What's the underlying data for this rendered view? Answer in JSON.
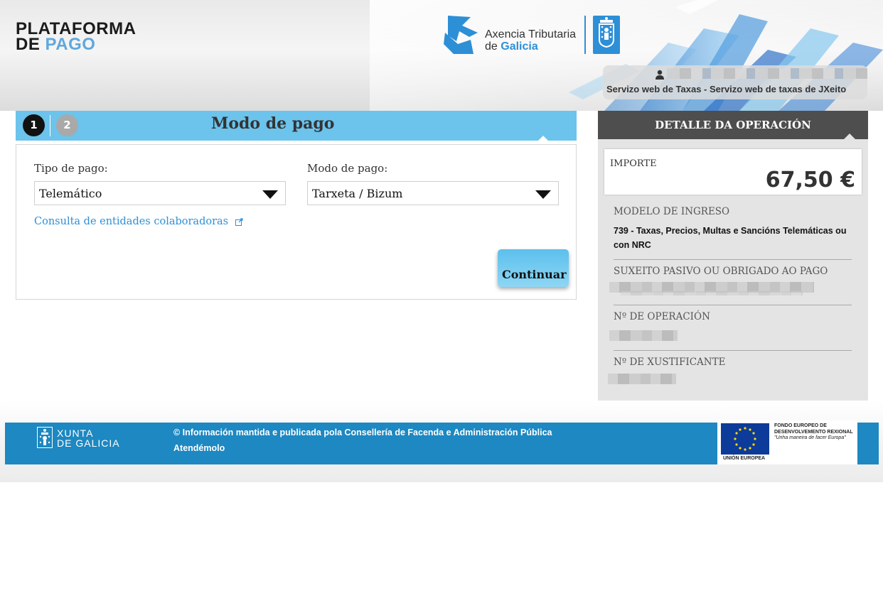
{
  "header": {
    "logo_line1": "PLATAFORMA",
    "logo_line2_a": "DE ",
    "logo_line2_b": "PAGO",
    "agency_line1": "Axencia Tributaria",
    "agency_line2_a": "de ",
    "agency_line2_b": "Galicia",
    "service_text": "Servizo web de Taxas - Servizo web de taxas de JXeito"
  },
  "steps": {
    "step1": "1",
    "step2": "2",
    "title": "Modo de pago"
  },
  "form": {
    "tipo_label": "Tipo de pago:",
    "tipo_value": "Telemático",
    "modo_label": "Modo de pago:",
    "modo_value": "Tarxeta / Bizum",
    "entidades_link": "Consulta de entidades colaboradoras",
    "continue_label": "Continuar"
  },
  "detail": {
    "title": "DETALLE DA OPERACIÓN",
    "importe_label": "IMPORTE",
    "importe_value": "67,50 €",
    "modelo_label": "MODELO DE INGRESO",
    "modelo_value": "739 - Taxas, Precios, Multas e Sancións Telemáticas ou con NRC",
    "suxeito_label": "SUXEITO PASIVO OU OBRIGADO AO PAGO",
    "operacion_label": "Nº DE OPERACIÓN",
    "xustificante_label": "Nº DE XUSTIFICANTE"
  },
  "footer": {
    "xunta_line1": "XUNTA",
    "xunta_line2": "DE GALICIA",
    "copyright": "© Información mantida e publicada pola Consellería de Facenda e Administración Pública",
    "atendemolo": "Atendémolo",
    "eu_fund": "FONDO EUROPEO DE DESENVOLVEMENTO REXIONAL",
    "eu_slogan": "\"Unha maneira de facer Europa\"",
    "eu_union": "UNIÓN EUROPEA"
  },
  "colors": {
    "accent_blue": "#6cc3ec",
    "link_blue": "#2d8fd6",
    "footer_blue": "#1d88c1",
    "detail_header": "#4e4e4e"
  }
}
